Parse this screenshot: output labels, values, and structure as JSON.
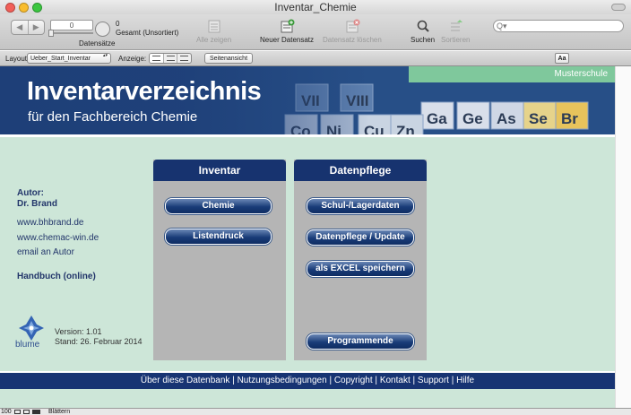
{
  "window": {
    "title": "Inventar_Chemie"
  },
  "toolbar": {
    "nav_prev": "◀",
    "nav_next": "▶",
    "record_current": "0",
    "record_count": "0",
    "record_total": "Gesamt (Unsortiert)",
    "records_label": "Datensätze",
    "show_all": "Alle zeigen",
    "new_record": "Neuer Datensatz",
    "delete_record": "Datensatz löschen",
    "search": "Suchen",
    "sort": "Sortieren",
    "search_placeholder": "Q▾"
  },
  "layoutbar": {
    "layout_label": "Layout:",
    "layout_value": "Ueber_Start_Inventar",
    "view_label": "Anzeige:",
    "preview_button": "Seitenansicht",
    "text_button": "Aa"
  },
  "banner": {
    "school": "Musterschule",
    "title": "Inventarverzeichnis",
    "subtitle": "für den Fachbereich Chemie",
    "elements": [
      "VII",
      "VIII",
      "Ga",
      "Ge",
      "As",
      "Se",
      "Br",
      "Cu",
      "Zn",
      "Ni",
      "Co"
    ]
  },
  "info": {
    "author_label": "Autor:",
    "author_name": "Dr. Brand",
    "site1": "www.bhbrand.de",
    "site2": "www.chemac-win.de",
    "email": "email an Autor",
    "manual": "Handbuch (online)",
    "logo_text": "blume",
    "version": "Version: 1.01",
    "date": "Stand: 26. Februar 2014"
  },
  "panels": {
    "inventar": {
      "title": "Inventar",
      "buttons": [
        "Chemie",
        "Listendruck"
      ]
    },
    "datenpflege": {
      "title": "Datenpflege",
      "buttons": [
        "Schul-/Lagerdaten",
        "Datenpflege / Update",
        "als EXCEL speichern",
        "Programmende"
      ]
    }
  },
  "footer": {
    "links": [
      "Über diese Datenbank",
      "Nutzungsbedingungen",
      "Copyright",
      "Kontakt",
      "Support",
      "Hilfe"
    ],
    "separator": "|"
  },
  "status": {
    "zoom": "100",
    "mode": "Blättern"
  },
  "colors": {
    "navy": "#17336f",
    "mint": "#cde6d8",
    "panel_grey": "#b5b5b5",
    "green": "#7fc89c"
  }
}
